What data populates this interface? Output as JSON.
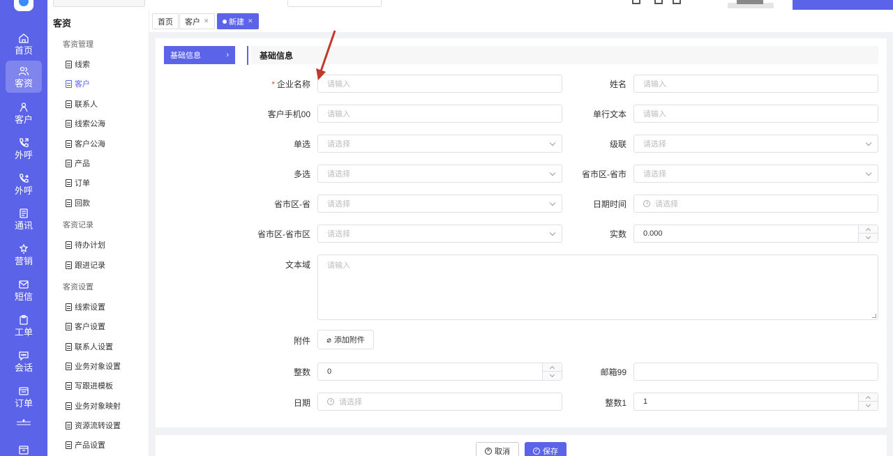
{
  "nav_rail": {
    "items": [
      {
        "label": "首页",
        "icon": "home-icon"
      },
      {
        "label": "客资",
        "icon": "users-icon"
      },
      {
        "label": "客户",
        "icon": "person-icon"
      },
      {
        "label": "外呼",
        "icon": "phone-out-icon"
      },
      {
        "label": "外呼",
        "icon": "phone-call-icon"
      },
      {
        "label": "通讯",
        "icon": "address-book-icon"
      },
      {
        "label": "营销",
        "icon": "marketing-icon"
      },
      {
        "label": "短信",
        "icon": "sms-icon"
      },
      {
        "label": "工单",
        "icon": "clipboard-icon"
      },
      {
        "label": "会话",
        "icon": "chat-icon"
      },
      {
        "label": "订单",
        "icon": "order-icon"
      }
    ],
    "active_index": 1
  },
  "sidebar": {
    "title": "客资",
    "groups": [
      {
        "label": "客资管理",
        "items": [
          "线索",
          "客户",
          "联系人",
          "线索公海",
          "客户公海",
          "产品",
          "订单",
          "回款"
        ]
      },
      {
        "label": "客资记录",
        "items": [
          "待办计划",
          "跟进记录"
        ]
      },
      {
        "label": "客资设置",
        "items": [
          "线索设置",
          "客户设置",
          "联系人设置",
          "业务对象设置",
          "写跟进模板",
          "业务对象映射",
          "资源流转设置",
          "产品设置"
        ]
      }
    ],
    "active_item": "客户"
  },
  "tabs": [
    {
      "label": "首页",
      "closable": false
    },
    {
      "label": "客户",
      "closable": true
    },
    {
      "label": "新建",
      "closable": true,
      "active": true
    }
  ],
  "form_nav": {
    "label": "基础信息"
  },
  "section": {
    "title": "基础信息"
  },
  "form": {
    "company_name": {
      "label": "企业名称",
      "placeholder": "请输入",
      "required": true
    },
    "name": {
      "label": "姓名",
      "placeholder": "请输入"
    },
    "phone": {
      "label": "客户手机00",
      "placeholder": "请输入"
    },
    "single_text": {
      "label": "单行文本",
      "placeholder": "请输入"
    },
    "single_select": {
      "label": "单选",
      "placeholder": "请选择"
    },
    "cascade": {
      "label": "级联",
      "placeholder": "请选择"
    },
    "multi_select": {
      "label": "多选",
      "placeholder": "请选择"
    },
    "region_prov_city": {
      "label": "省市区-省市",
      "placeholder": "请选择"
    },
    "region_prov": {
      "label": "省市区-省",
      "placeholder": "请选择"
    },
    "datetime": {
      "label": "日期时间",
      "placeholder": "请选择"
    },
    "region_full": {
      "label": "省市区-省市区",
      "placeholder": "请选择"
    },
    "real_number": {
      "label": "实数",
      "value": "0.000"
    },
    "textarea": {
      "label": "文本域",
      "placeholder": "请输入"
    },
    "attachment": {
      "label": "附件",
      "button": "添加附件"
    },
    "integer": {
      "label": "整数",
      "value": "0"
    },
    "email": {
      "label": "邮箱99",
      "value": ""
    },
    "date": {
      "label": "日期",
      "placeholder": "请选择"
    },
    "integer1": {
      "label": "整数1",
      "value": "1"
    }
  },
  "footer": {
    "cancel_label": "取消",
    "save_label": "保存"
  },
  "colors": {
    "accent": "#5b63e8",
    "required": "#e74c3c",
    "annotation_arrow": "#c0392b"
  }
}
